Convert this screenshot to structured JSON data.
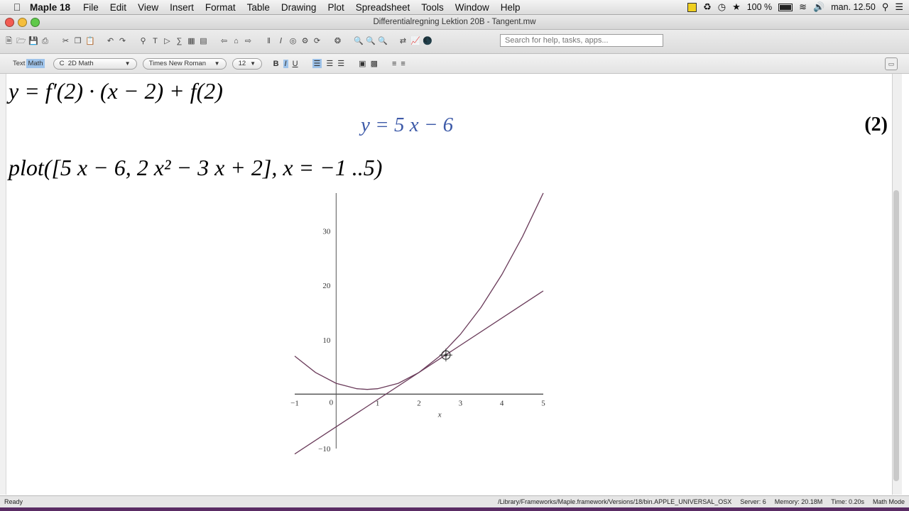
{
  "menubar": {
    "apple": "",
    "app": "Maple 18",
    "items": [
      "File",
      "Edit",
      "View",
      "Insert",
      "Format",
      "Table",
      "Drawing",
      "Plot",
      "Spreadsheet",
      "Tools",
      "Window",
      "Help"
    ],
    "battery": "100 %",
    "clock": "man. 12.50"
  },
  "window": {
    "title": "Differentialregning Lektion 20B - Tangent.mw"
  },
  "toolbar": {
    "search_placeholder": "Search for help, tasks, apps..."
  },
  "format_bar": {
    "text_label": "Text",
    "math_label": "Math",
    "style": "2D Math",
    "style_prefix": "C",
    "font": "Times New Roman",
    "size": "12",
    "bold": "B",
    "italic": "I",
    "underline": "U"
  },
  "worksheet": {
    "line1": "y = f′(2) · (x − 2) + f(2)",
    "result": "y = 5 x − 6",
    "equation_number": "(2)",
    "line3": "plot([5 x − 6, 2 x² − 3 x + 2], x = −1 ..5)"
  },
  "chart_data": {
    "type": "line",
    "xlabel": "x",
    "xlim": [
      -1,
      5
    ],
    "ylim": [
      -10,
      37
    ],
    "x_ticks": [
      "−1",
      "0",
      "1",
      "2",
      "3",
      "4",
      "5"
    ],
    "y_ticks": [
      "−10",
      "10",
      "20",
      "30"
    ],
    "series": [
      {
        "expression": "5x-6",
        "x": [
          -1,
          5
        ],
        "y": [
          -11,
          19
        ]
      },
      {
        "expression": "2x^2-3x+2",
        "x": [
          -1,
          -0.5,
          0,
          0.5,
          0.75,
          1,
          1.5,
          2,
          2.5,
          3,
          3.5,
          4,
          4.5,
          5
        ],
        "y": [
          7,
          4,
          2,
          1,
          0.875,
          1,
          2,
          4,
          7,
          11,
          16,
          22,
          29,
          37
        ]
      }
    ],
    "colors": {
      "curve": "#6a3b5a"
    }
  },
  "statusbar": {
    "state": "Ready",
    "path": "/Library/Frameworks/Maple.framework/Versions/18/bin.APPLE_UNIVERSAL_OSX",
    "server": "Server: 6",
    "memory": "Memory: 20.18M",
    "time": "Time: 0.20s",
    "mode": "Math Mode"
  }
}
